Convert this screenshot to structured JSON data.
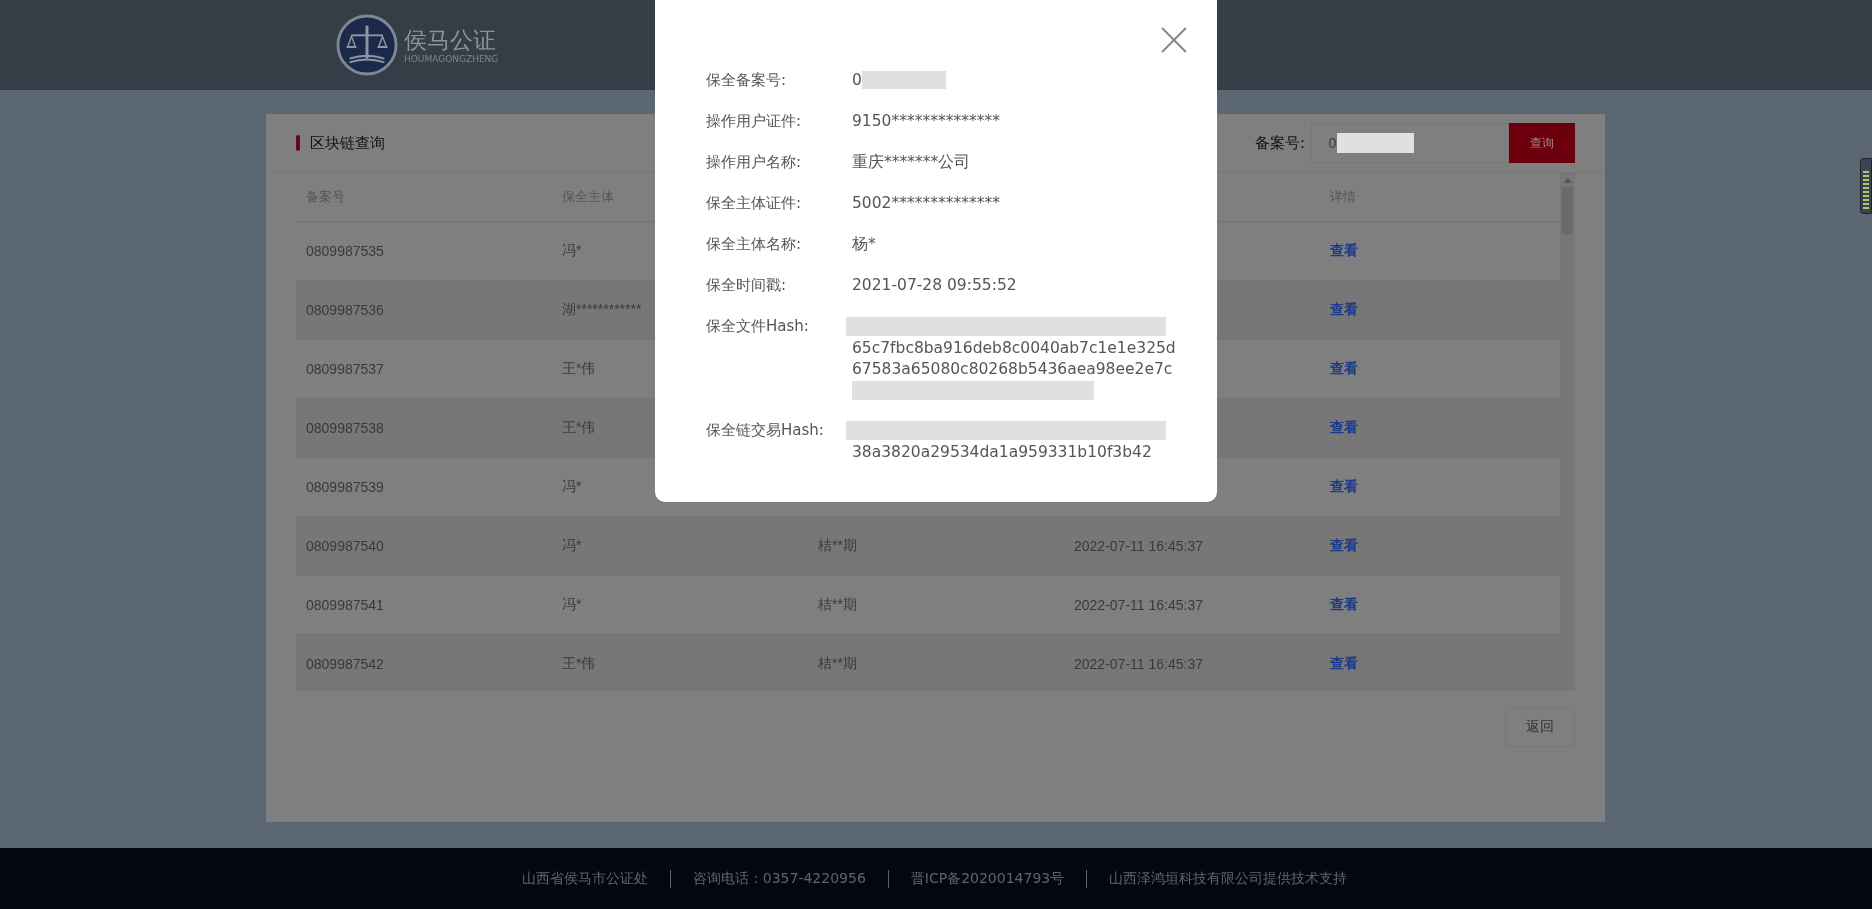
{
  "header": {
    "logo_title": "侯马公证",
    "logo_subtitle": "HOUMAGONGZHENG"
  },
  "panel": {
    "title": "区块链查询",
    "search": {
      "label": "备案号:",
      "value": "0",
      "redacted": true
    },
    "search_button": "查询",
    "table": {
      "columns": [
        {
          "header": "备案号"
        },
        {
          "header": "保全主体"
        },
        {},
        {},
        {
          "header": "详情"
        }
      ],
      "rows": [
        {
          "number": "0809987535",
          "subject": "冯*",
          "link": "查看"
        },
        {
          "number": "0809987536",
          "subject": "湖************",
          "link": "查看"
        },
        {
          "number": "0809987537",
          "subject": "王*伟",
          "link": "查看"
        },
        {
          "number": "0809987538",
          "subject": "王*伟",
          "link": "查看"
        },
        {
          "number": "0809987539",
          "subject": "冯*",
          "link": "查看"
        },
        {
          "number": "0809987540",
          "subject": "冯*",
          "column_3": "桔**期",
          "column_4": "2022-07-11 16:45:37",
          "link": "查看"
        },
        {
          "number": "0809987541",
          "subject": "冯*",
          "column_3": "桔**期",
          "column_4": "2022-07-11 16:45:37",
          "link": "查看"
        },
        {
          "number": "0809987542",
          "subject": "王*伟",
          "column_3": "桔**期",
          "column_4": "2022-07-11 16:45:37",
          "link": "查看"
        }
      ]
    },
    "back_button": "返回"
  },
  "dialog": {
    "fields": [
      {
        "label": "保全备案号:",
        "lines": [
          {
            "text": "0",
            "redacted": true
          }
        ]
      },
      {
        "label": "操作用户证件:",
        "lines": [
          {
            "text": "9150**************",
            "redacted": false
          }
        ]
      },
      {
        "label": "操作用户名称:",
        "lines": [
          {
            "text": "重庆*******公司",
            "redacted": false
          }
        ]
      },
      {
        "label": "保全主体证件:",
        "lines": [
          {
            "text": "5002**************",
            "redacted": false
          }
        ]
      },
      {
        "label": "保全主体名称:",
        "lines": [
          {
            "text": "杨*",
            "redacted": false
          }
        ]
      },
      {
        "label": "保全时间戳:",
        "lines": [
          {
            "text": "2021-07-28 09:55:52",
            "redacted": false
          }
        ]
      },
      {
        "label": "保全文件Hash:",
        "lines": [
          {
            "redacted": true
          },
          {
            "text": "65c7fbc8ba916deb8c0040ab7c1e1e325d",
            "redacted": false
          },
          {
            "text": "67583a65080c80268b5436aea98ee2e7c",
            "redacted": false
          },
          {
            "redacted": true
          }
        ]
      },
      {
        "label": "保全链交易Hash:",
        "lines": [
          {
            "redacted": true
          },
          {
            "text": "38a3820a29534da1a959331b10f3b42",
            "redacted": false
          }
        ]
      }
    ]
  },
  "footer": {
    "items": [
      "山西省侯马市公证处",
      "咨询电话：0357-4220956",
      "晋ICP备2020014793号",
      "山西泽鸿垣科技有限公司提供技术支持"
    ]
  }
}
